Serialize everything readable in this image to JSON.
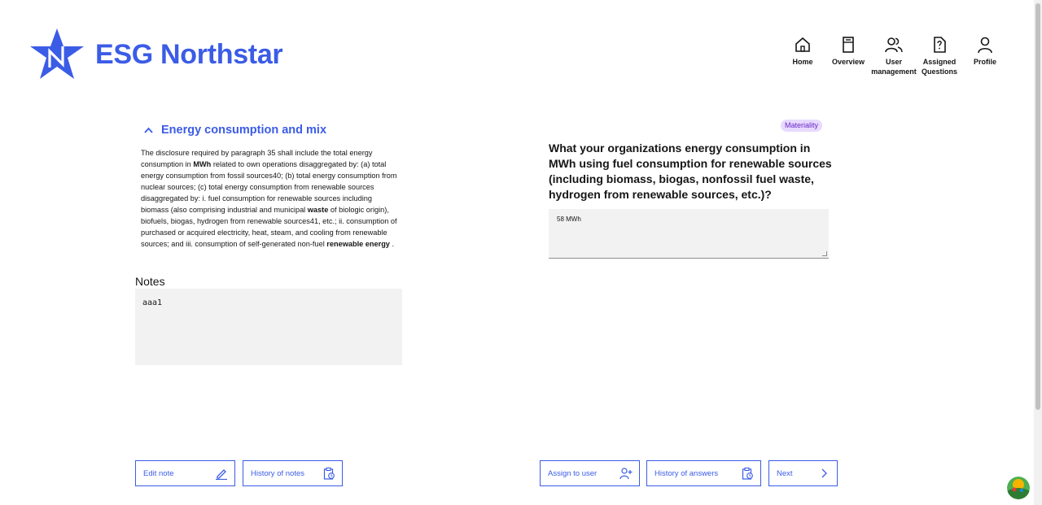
{
  "app": {
    "name": "ESG Northstar",
    "brand_color": "#3b5ce6"
  },
  "nav": {
    "items": [
      {
        "label": "Home",
        "icon": "home-icon"
      },
      {
        "label": "Overview",
        "icon": "overview-icon"
      },
      {
        "label": "User management",
        "icon": "users-icon"
      },
      {
        "label": "Assigned Questions",
        "icon": "assigned-document-icon"
      },
      {
        "label": "Profile",
        "icon": "profile-icon"
      }
    ]
  },
  "section": {
    "title": "Energy consumption and mix",
    "description": {
      "p1": "The disclosure required by paragraph 35 shall include the total energy consumption in ",
      "b1": "MWh",
      "p2": " related to own operations disaggregated by: (a) total energy consumption from fossil sources40; (b) total energy consumption from nuclear sources; (c) total energy consumption from renewable sources disaggregated by: i. fuel consumption for renewable sources including biomass (also comprising industrial and municipal ",
      "b2": "waste",
      "p3": " of biologic origin), biofuels, biogas, hydrogen from renewable sources41, etc.; ii. consumption of purchased or acquired electricity, heat, steam, and cooling from renewable sources; and iii. consumption of self-generated non-fuel ",
      "b3": "renewable energy",
      "p4": " ."
    }
  },
  "notes": {
    "label": "Notes",
    "value": "aaa1"
  },
  "question": {
    "tag": "Materiality",
    "text": "What your organizations energy consumption in MWh using fuel consumption for renewable sources (including biomass, biogas, nonfossil fuel waste, hydrogen from renewable sources, etc.)?",
    "answer": "58 MWh"
  },
  "buttons": {
    "edit_note": "Edit note",
    "history_notes": "History of notes",
    "assign_user": "Assign to user",
    "history_answers": "History of answers",
    "next": "Next"
  }
}
